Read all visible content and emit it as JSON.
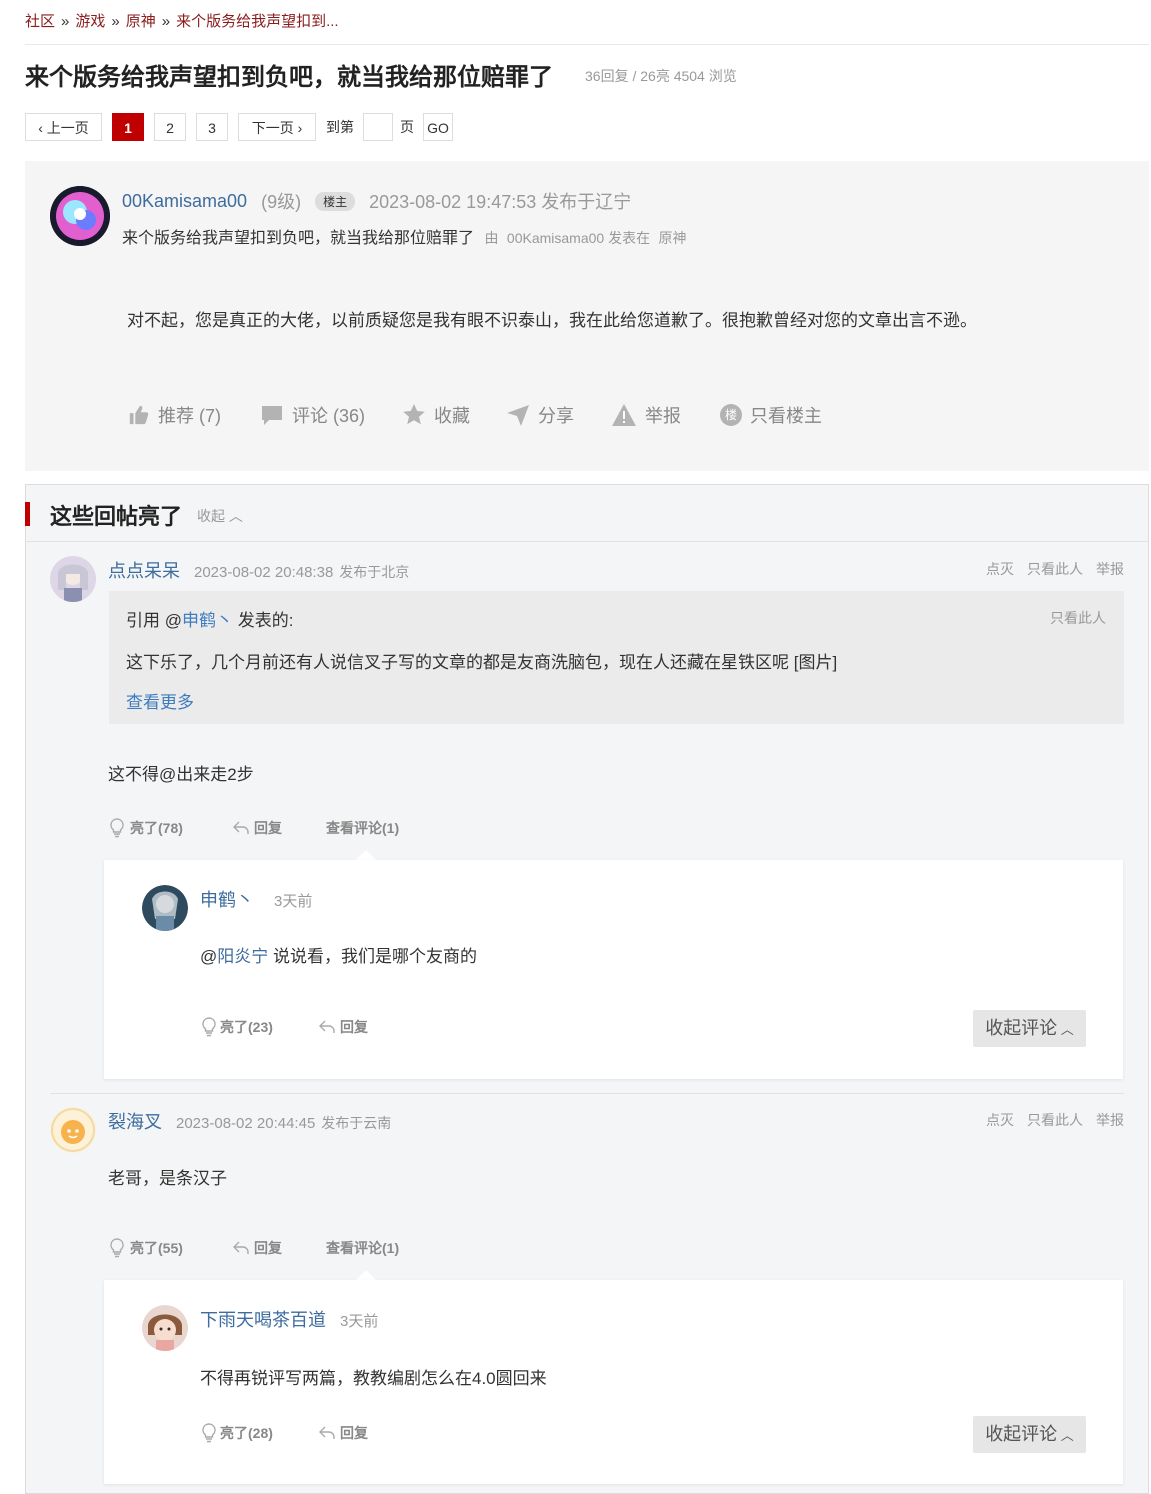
{
  "breadcrumb": [
    "社区",
    "游戏",
    "原神",
    "来个版务给我声望扣到..."
  ],
  "breadcrumb_sep": "»",
  "post": {
    "title": "来个版务给我声望扣到负吧，就当我给那位赔罪了",
    "stats": "36回复 / 26亮 4504 浏览"
  },
  "pagination": {
    "prev": "上一页",
    "pages": [
      "1",
      "2",
      "3"
    ],
    "next": "下一页",
    "goto_prefix": "到第",
    "goto_suffix": "页",
    "go": "GO"
  },
  "op": {
    "username": "00Kamisama00",
    "level": "(9级)",
    "badge": "楼主",
    "time": "2023-08-02 19:47:53 发布于辽宁",
    "subtitle": "来个版务给我声望扣到负吧，就当我给那位赔罪了",
    "by_prefix": "由",
    "by_user": "00Kamisama00 发表在",
    "by_board": "原神",
    "content": "对不起，您是真正的大佬，以前质疑您是我有眼不识泰山，我在此给您道歉了。很抱歉曾经对您的文章出言不逊。",
    "actions": {
      "recommend": "推荐 (7)",
      "comment": "评论 (36)",
      "favorite": "收藏",
      "share": "分享",
      "report": "举报",
      "only_op": "只看楼主"
    },
    "only_op_glyph": "楼"
  },
  "highlights": {
    "title": "这些回帖亮了",
    "collapse": "收起",
    "links": {
      "downvote": "点灭",
      "only_this": "只看此人",
      "report": "举报"
    },
    "replies": [
      {
        "username": "点点呆呆",
        "time": "2023-08-02 20:48:38",
        "location": "发布于北京",
        "quote": {
          "prefix": "引用 @",
          "user": "申鹤丶",
          "suffix": " 发表的:",
          "only_this": "只看此人",
          "text": "这下乐了，几个月前还有人说信叉子写的文章的都是友商洗脑包，现在人还藏在星铁区呢 [图片]",
          "more": "查看更多"
        },
        "content": "这不得@出来走2步",
        "like": "亮了(78)",
        "reply": "回复",
        "view_comments": "查看评论(1)",
        "comment": {
          "username": "申鹤丶",
          "time": "3天前",
          "at": "@",
          "mention": "阳炎宁",
          "text": " 说说看，我们是哪个友商的",
          "like": "亮了(23)",
          "reply": "回复",
          "collapse": "收起评论"
        }
      },
      {
        "username": "裂海叉",
        "time": "2023-08-02 20:44:45",
        "location": "发布于云南",
        "content": "老哥，是条汉子",
        "like": "亮了(55)",
        "reply": "回复",
        "view_comments": "查看评论(1)",
        "comment": {
          "username": "下雨天喝茶百道",
          "time": "3天前",
          "text": "不得再锐评写两篇，教教编剧怎么在4.0圆回来",
          "like": "亮了(28)",
          "reply": "回复",
          "collapse": "收起评论"
        }
      }
    ]
  },
  "colors": {
    "accent_red": "#c00000",
    "breadcrumb": "#8a1c1c",
    "username_blue": "#3e6c9e",
    "link_blue": "#3e7cc0",
    "mention_blue": "#3e6c9e",
    "highlight_bg": "#f4f5f6",
    "op_bg": "#f5f5f5"
  }
}
